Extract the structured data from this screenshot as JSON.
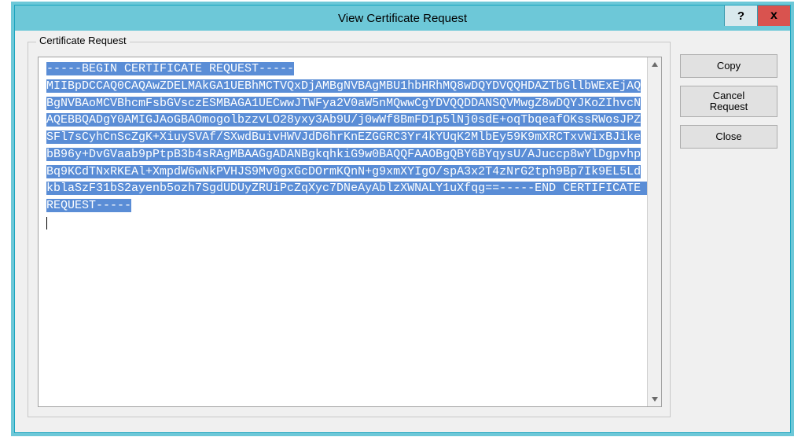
{
  "titlebar": {
    "title": "View Certificate Request",
    "help": "?",
    "close": "x"
  },
  "groupbox": {
    "label": "Certificate Request"
  },
  "certificate_text": "-----BEGIN CERTIFICATE REQUEST-----\nMIIBpDCCAQ0CAQAwZDELMAkGA1UEBhMCTVQxDjAMBgNVBAgMBU1hbHRhMQ8wDQYDVQQHDAZTbGllbWExEjAQBgNVBAoMCVBhcmFsbGVsczESMBAGA1UECwwJTWFya2V0aW5nMQwwCgYDVQQDDANSQVMwgZ8wDQYJKoZIhvcNAQEBBQADgY0AMIGJAoGBAOmogolbzzvLO28yxy3Ab9U/j0wWf8BmFD1p5lNj0sdE+oqTbqeafOKssRWosJPZSFl7sCyhCnScZgK+XiuySVAf/SXwdBuivHWVJdD6hrKnEZGGRC3Yr4kYUqK2MlbEy59K9mXRCTxvWixBJikebB96y+DvGVaab9pPtpB3b4sRAgMBAAGgADANBgkqhkiG9w0BAQQFAAOBgQBY6BYqysU/AJuccp8wYlDgpvhpBq9KCdTNxRKEAl+XmpdW6wNkPVHJS9Mv0gxGcDOrmKQnN+g9xmXYIgO/spA3x2T4zNrG2tph9Bp7Ik9EL5LdkblaSzF31bS2ayenb5ozh7SgdUDUyZRUiPcZqXyc7DNeAyAblzXWNALY1uXfqg==-----END CERTIFICATE REQUEST-----",
  "buttons": {
    "copy": "Copy",
    "cancel_request": "Cancel\nRequest",
    "close": "Close"
  }
}
